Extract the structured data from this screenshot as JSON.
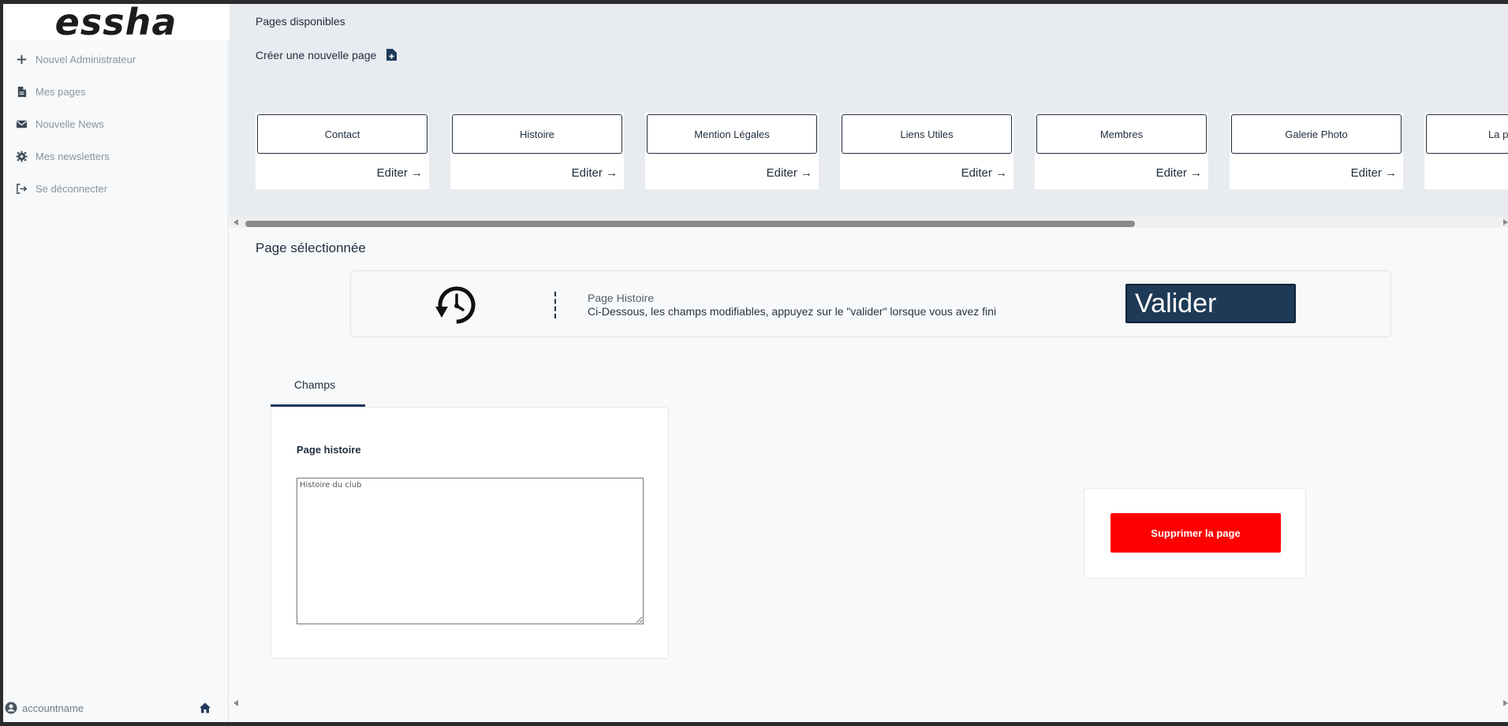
{
  "sidebar": {
    "logo": "essha",
    "items": [
      {
        "label": "Nouvel Administrateur",
        "icon": "plus-icon"
      },
      {
        "label": "Mes pages",
        "icon": "document-icon"
      },
      {
        "label": "Nouvelle News",
        "icon": "envelope-icon"
      },
      {
        "label": "Mes newsletters",
        "icon": "gear-icon"
      },
      {
        "label": "Se déconnecter",
        "icon": "logout-icon"
      }
    ],
    "account": "accountname"
  },
  "pages": {
    "title": "Pages disponibles",
    "create_label": "Créer une nouvelle page",
    "edit_label": "Editer →",
    "cards": [
      "Contact",
      "Histoire",
      "Mention Légales",
      "Liens Utiles",
      "Membres",
      "Galerie Photo",
      "La p"
    ]
  },
  "selected": {
    "title": "Page sélectionnée",
    "page_name": "Page Histoire",
    "instructions": "Ci-Dessous, les champs modifiables, appuyez sur le \"valider\" lorsque vous avez fini",
    "validate_label": "Valider",
    "tab_label": "Champs",
    "field_label": "Page histoire",
    "field_value": "Histoire du club",
    "delete_label": "Supprimer la page"
  },
  "colors": {
    "accent": "#1e3a57",
    "danger": "#ff0000",
    "top_panel": "#e8ebf0"
  }
}
